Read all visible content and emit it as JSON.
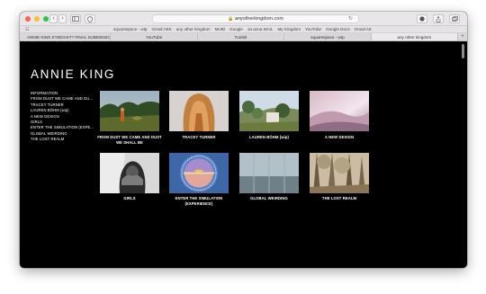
{
  "browser": {
    "url": "anyotherkingdom.com",
    "bookmarks": [
      "squarespace - wtp",
      "Gmail AEK",
      "any other kingdom",
      "MUBI",
      "Google",
      "1a anna MAIL",
      "My Kingdom",
      "YouTube",
      "Google Docs",
      "Gmail AK"
    ],
    "tabs": [
      {
        "label": "ANNIE KING KYBOAST? FINAL SUBMISSIO..."
      },
      {
        "label": "YouTube"
      },
      {
        "label": "Tumblr"
      },
      {
        "label": "squarespace - wtp"
      },
      {
        "label": "any other kingdom"
      }
    ]
  },
  "site": {
    "title": "ANNIE KING",
    "nav": [
      "INFORMATION",
      "FROM DUST WE CAME AND DU...",
      "TRACEY TURNER",
      "LAUREN BÖHM (wip)",
      "A NEW DESIGN",
      "GIRLS",
      "ENTER THE SIMULATION (EXPE...",
      "GLOBAL WEIRDING",
      "THE LOST REALM"
    ],
    "works": [
      {
        "caption_1": "FROM DUST WE CAME AND DUST",
        "caption_2": "WE SHALL BE"
      },
      {
        "caption_1": "TRACEY TURNER",
        "caption_2": ""
      },
      {
        "caption_1": "LAUREN BÖHM (wip)",
        "caption_2": ""
      },
      {
        "caption_1": "A NEW DESIGN",
        "caption_2": ""
      },
      {
        "caption_1": "GIRLS",
        "caption_2": ""
      },
      {
        "caption_1": "ENTER THE SIMULATION",
        "caption_2": "(EXPERIENCE)"
      },
      {
        "caption_1": "GLOBAL WEIRDING",
        "caption_2": ""
      },
      {
        "caption_1": "THE LOST REALM",
        "caption_2": ""
      }
    ]
  }
}
